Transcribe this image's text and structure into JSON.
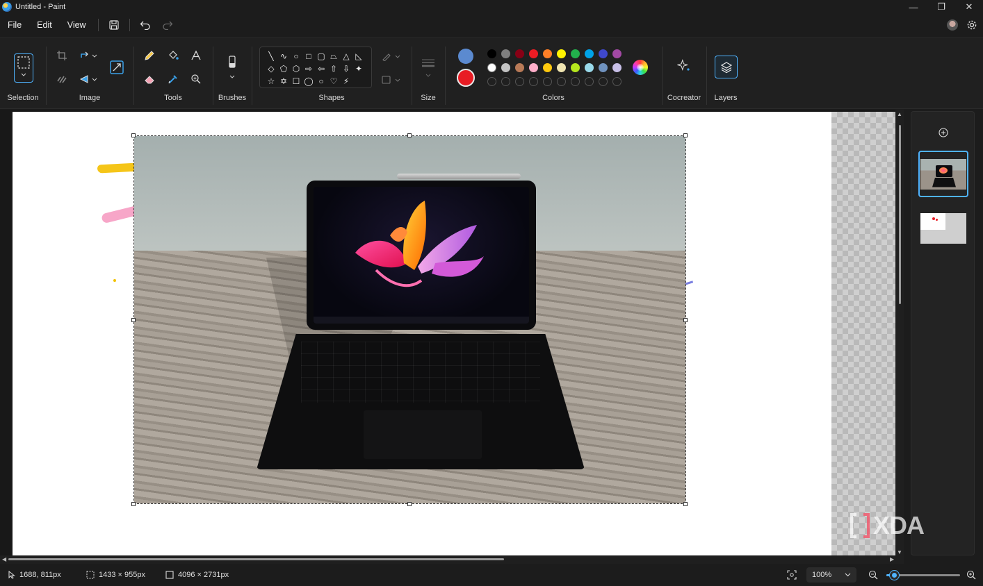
{
  "window": {
    "title": "Untitled - Paint",
    "minimize": "—",
    "maximize": "❐",
    "close": "✕"
  },
  "menu": {
    "file": "File",
    "edit": "Edit",
    "view": "View"
  },
  "ribbon": {
    "selection_label": "Selection",
    "image_label": "Image",
    "tools_label": "Tools",
    "brushes_label": "Brushes",
    "shapes_label": "Shapes",
    "size_label": "Size",
    "colors_label": "Colors",
    "cocreator_label": "Cocreator",
    "layers_label": "Layers",
    "shapes": [
      "╲",
      "∿",
      "○",
      "□",
      "▢",
      "⏢",
      "△",
      "◺",
      "◇",
      "⬠",
      "⬡",
      "⇨",
      "⇦",
      "⇧",
      "⇩",
      "✦",
      "☆",
      "✡",
      "☐",
      "◯",
      "○",
      "♡",
      "⚡",
      ""
    ],
    "primary_color": "#5b8ad0",
    "secondary_color": "#e81c24",
    "palette_row1": [
      "#000000",
      "#7f7f7f",
      "#880015",
      "#ed1c24",
      "#ff7f27",
      "#fff200",
      "#22b14c",
      "#00a2e8",
      "#3f48cc",
      "#a349a4"
    ],
    "palette_row2": [
      "#ffffff",
      "#c3c3c3",
      "#b97a57",
      "#ffaec9",
      "#ffc90e",
      "#efe4b0",
      "#b5e61d",
      "#99d9ea",
      "#7092be",
      "#c8bfe7"
    ]
  },
  "status": {
    "cursor_pos": "1688, 811px",
    "selection_size": "1433 × 955px",
    "canvas_size": "4096 × 2731px",
    "zoom": "100%",
    "zoom_level": 0.1
  },
  "layers": {
    "count": 2,
    "active_index": 0
  },
  "watermark": "XDA"
}
